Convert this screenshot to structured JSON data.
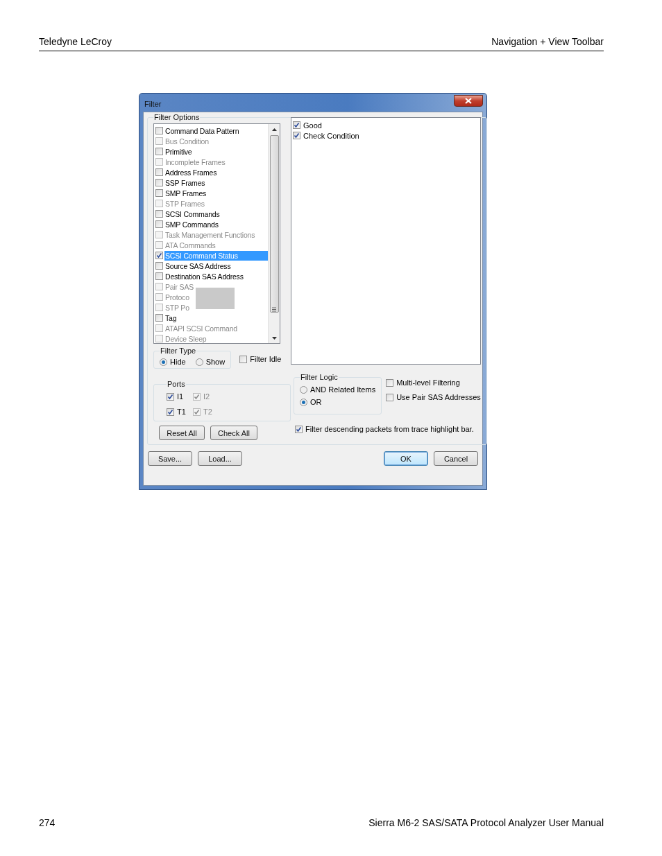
{
  "page_header": {
    "left": "Teledyne LeCroy",
    "right": "Navigation + View Toolbar"
  },
  "dialog": {
    "title": "Filter",
    "filter_options": {
      "label": "Filter Options",
      "items": [
        {
          "label": "Command Data Pattern",
          "checked": false,
          "disabled": false,
          "selected": false
        },
        {
          "label": "Bus Condition",
          "checked": false,
          "disabled": true,
          "selected": false
        },
        {
          "label": "Primitive",
          "checked": false,
          "disabled": false,
          "selected": false
        },
        {
          "label": "Incomplete Frames",
          "checked": false,
          "disabled": true,
          "selected": false
        },
        {
          "label": "Address Frames",
          "checked": false,
          "disabled": false,
          "selected": false
        },
        {
          "label": "SSP Frames",
          "checked": false,
          "disabled": false,
          "selected": false
        },
        {
          "label": "SMP Frames",
          "checked": false,
          "disabled": false,
          "selected": false
        },
        {
          "label": "STP Frames",
          "checked": false,
          "disabled": true,
          "selected": false
        },
        {
          "label": "SCSI Commands",
          "checked": false,
          "disabled": false,
          "selected": false
        },
        {
          "label": "SMP Commands",
          "checked": false,
          "disabled": false,
          "selected": false
        },
        {
          "label": "Task Management Functions",
          "checked": false,
          "disabled": true,
          "selected": false
        },
        {
          "label": "ATA Commands",
          "checked": false,
          "disabled": true,
          "selected": false
        },
        {
          "label": "SCSI Command Status",
          "checked": true,
          "disabled": false,
          "selected": true
        },
        {
          "label": "Source SAS Address",
          "checked": false,
          "disabled": false,
          "selected": false
        },
        {
          "label": "Destination SAS Address",
          "checked": false,
          "disabled": false,
          "selected": false
        },
        {
          "label": "Pair SAS",
          "checked": false,
          "disabled": true,
          "selected": false
        },
        {
          "label": "Protoco",
          "checked": false,
          "disabled": true,
          "selected": false
        },
        {
          "label": "STP Po",
          "checked": false,
          "disabled": true,
          "selected": false
        },
        {
          "label": "Tag",
          "checked": false,
          "disabled": false,
          "selected": false
        },
        {
          "label": "ATAPI SCSI Command",
          "checked": false,
          "disabled": true,
          "selected": false
        },
        {
          "label": "Device Sleep",
          "checked": false,
          "disabled": true,
          "selected": false
        }
      ],
      "status_items": [
        {
          "label": "Good",
          "checked": true
        },
        {
          "label": "Check Condition",
          "checked": true
        }
      ]
    },
    "filter_type": {
      "label": "Filter Type",
      "options": [
        {
          "label": "Hide",
          "selected": true
        },
        {
          "label": "Show",
          "selected": false
        }
      ]
    },
    "filter_idle": {
      "label": "Filter Idle",
      "checked": false
    },
    "ports": {
      "label": "Ports",
      "items": [
        {
          "label": "I1",
          "checked": true,
          "disabled": false
        },
        {
          "label": "I2",
          "checked": true,
          "disabled": true
        },
        {
          "label": "T1",
          "checked": true,
          "disabled": false
        },
        {
          "label": "T2",
          "checked": true,
          "disabled": true
        }
      ]
    },
    "port_buttons": [
      "Reset All",
      "Check All"
    ],
    "filter_logic": {
      "label": "Filter Logic",
      "options": [
        {
          "label": "AND Related Items",
          "selected": false
        },
        {
          "label": "OR",
          "selected": true
        }
      ]
    },
    "options": [
      {
        "label": "Multi-level Filtering",
        "checked": false
      },
      {
        "label": "Use Pair SAS Addresses",
        "checked": false
      }
    ],
    "descending": {
      "label": "Filter descending packets from trace highlight bar.",
      "checked": true
    },
    "left_buttons": [
      {
        "label": "Save...",
        "default": false
      },
      {
        "label": "Load...",
        "default": false
      }
    ],
    "right_buttons": [
      {
        "label": "OK",
        "default": true
      },
      {
        "label": "Cancel",
        "default": false
      }
    ]
  },
  "page_footer": {
    "page_number": "274",
    "title": "Sierra M6-2 SAS/SATA Protocol Analyzer User Manual"
  }
}
